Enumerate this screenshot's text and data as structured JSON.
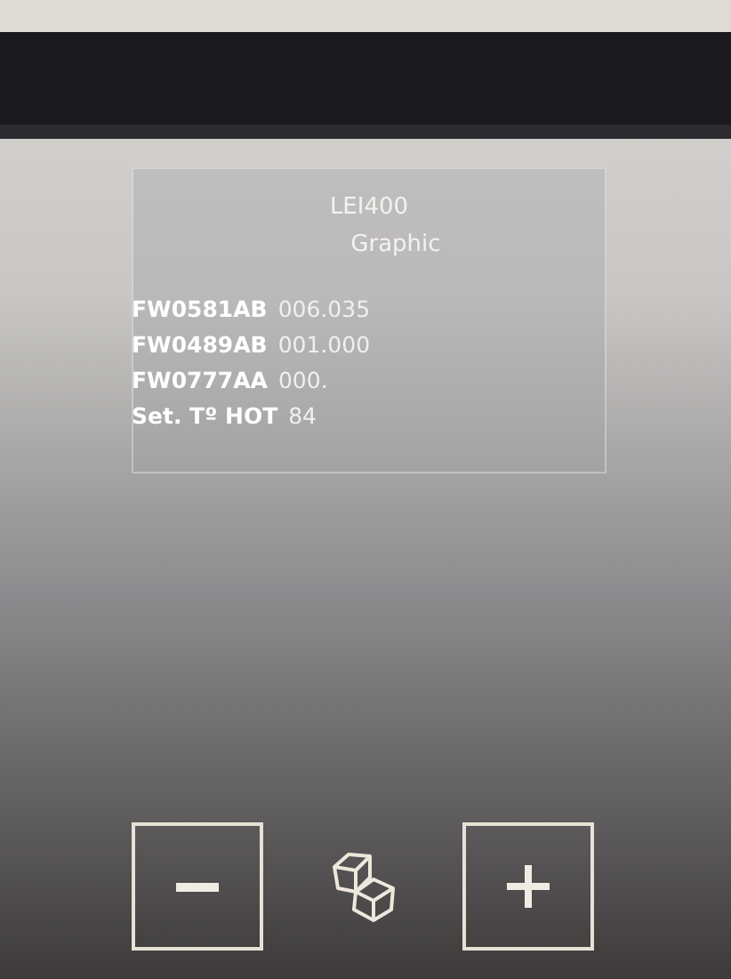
{
  "header": {
    "model": "LEI400",
    "mode": "Graphic"
  },
  "readings": [
    {
      "label": "FW0581AB",
      "value": "006.035"
    },
    {
      "label": "FW0489AB",
      "value": "001.000"
    },
    {
      "label": "FW0777AA",
      "value": "000."
    },
    {
      "label": "Set. Tº HOT",
      "value": "84"
    }
  ]
}
